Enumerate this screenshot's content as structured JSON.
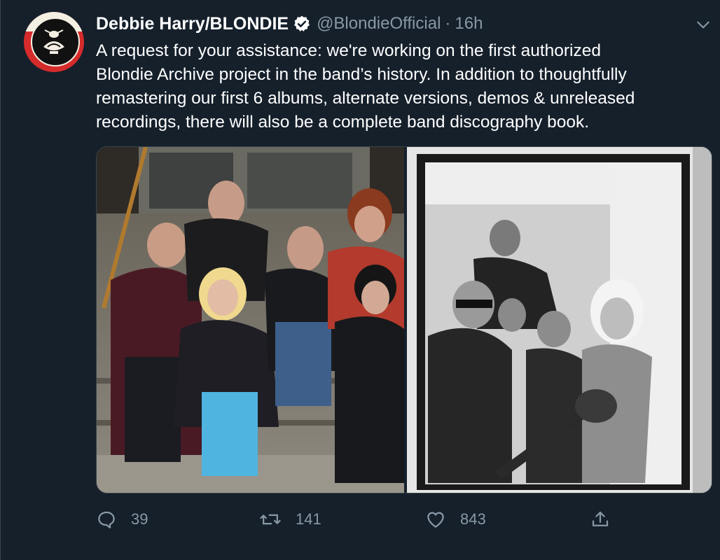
{
  "author": {
    "display_name": "Debbie Harry/BLONDIE",
    "handle": "@BlondieOfficial",
    "separator": "·",
    "time": "16h",
    "verified": true,
    "avatar_icon": "blondie-logo-icon"
  },
  "tweet": {
    "text_lines": [
      "A request for your assistance: we're working on the first authorized",
      "Blondie Archive project in the band’s history. In addition to thoughtfully",
      "remastering our first 6 albums, alternate versions, demos & unreleased",
      "recordings, there will also be a complete band discography book."
    ]
  },
  "media": {
    "photos": [
      {
        "kind": "color-photo",
        "depicts": "band-seated-on-steps"
      },
      {
        "kind": "black-and-white-photo",
        "depicts": "band-posing-with-guitar"
      }
    ]
  },
  "actions": {
    "reply_count": "39",
    "retweet_count": "141",
    "like_count": "843",
    "reply_icon": "reply-icon",
    "retweet_icon": "retweet-icon",
    "like_icon": "heart-icon",
    "share_icon": "share-icon"
  },
  "colors": {
    "background": "#15202b",
    "secondary_text": "#8899a6",
    "verified_badge": "#ffffff",
    "avatar_red": "#d62b2b"
  }
}
